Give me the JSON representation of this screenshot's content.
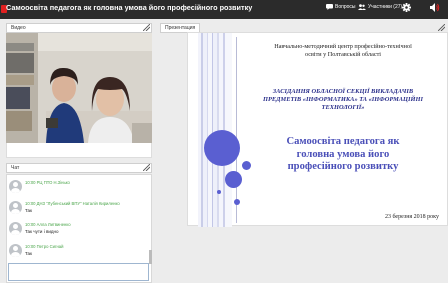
{
  "topbar": {
    "title": "Самоосвіта педагога як головна умова його професійного розвитку",
    "questions_label": "Вопросы",
    "participants_label": "Участники (27)"
  },
  "tabs": {
    "video": "Видео",
    "presentation": "Презентация",
    "chat": "Чат"
  },
  "chat": {
    "messages": [
      {
        "meta": "10:00 РЦ ПТО Н.Зінько",
        "text": ""
      },
      {
        "meta": "10:00 ДНЗ \"Лубенський ВПУ\" Наталія Кириленко",
        "text": "Так"
      },
      {
        "meta": "10:00 Алла Литвиненко",
        "text": "Так чути і видно"
      },
      {
        "meta": "10:00 Петро Сигнай",
        "text": "Так"
      }
    ],
    "input_value": ""
  },
  "slide": {
    "org": "Навчально-методичний центр професійно-технічної освіти у Полтавській області",
    "meeting": "ЗАСІДАННЯ ОБЛАСНОЇ СЕКЦІЇ ВИКЛАДАЧІВ ПРЕДМЕТІВ «ІНФОРМАТИКА» ТА «ІНФОРМАЦІЙНІ ТЕХНОЛОГІЇ»",
    "title": "Самоосвіта педагога як головна умова його професійного розвитку",
    "date": "23 березня 2018 року",
    "accent": "#5a5fd1"
  },
  "colors": {
    "topbar": "#2b2b2b",
    "record": "#e02020",
    "chat_meta": "#4aa54a",
    "slide_title": "#4a4fb8"
  }
}
